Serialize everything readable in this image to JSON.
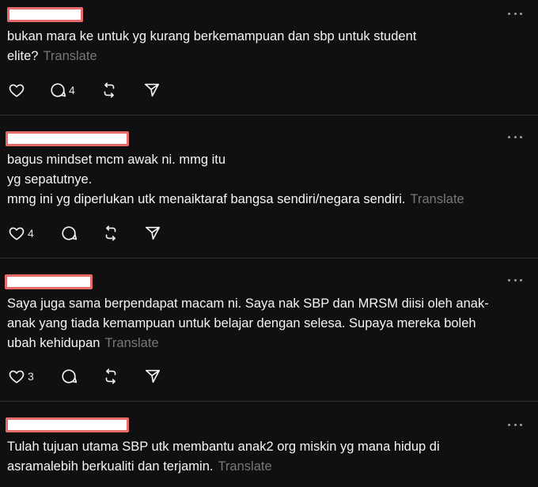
{
  "posts": [
    {
      "text": "bukan mara ke untuk yg kurang berkemampuan dan sbp untuk student\nelite?",
      "translate_label": "Translate",
      "like_count": "",
      "reply_count": "4"
    },
    {
      "text": "bagus mindset mcm awak ni. mmg itu\nyg sepatutnye.\nmmg ini yg diperlukan utk menaiktaraf bangsa sendiri/negara sendiri.",
      "translate_label": "Translate",
      "like_count": "4",
      "reply_count": ""
    },
    {
      "text": "Saya juga sama berpendapat macam ni. Saya nak SBP dan MRSM diisi oleh anak-\nanak yang tiada kemampuan untuk belajar dengan selesa. Supaya mereka boleh\nubah kehidupan",
      "translate_label": "Translate",
      "like_count": "3",
      "reply_count": ""
    },
    {
      "text": "Tulah tujuan utama SBP utk membantu anak2 org miskin yg mana hidup di\nasramalebih berkualiti dan terjamin.",
      "translate_label": "Translate",
      "like_count": "",
      "reply_count": ""
    }
  ],
  "icons": {
    "like": "heart-icon",
    "reply": "comment-icon",
    "repost": "repost-icon",
    "share": "send-icon",
    "more": "more-options-icon"
  },
  "colors": {
    "background": "#101010",
    "text": "#f3f5f7",
    "muted": "#777777",
    "divider": "#2d2d2d",
    "redaction_border": "#e86b6b"
  }
}
